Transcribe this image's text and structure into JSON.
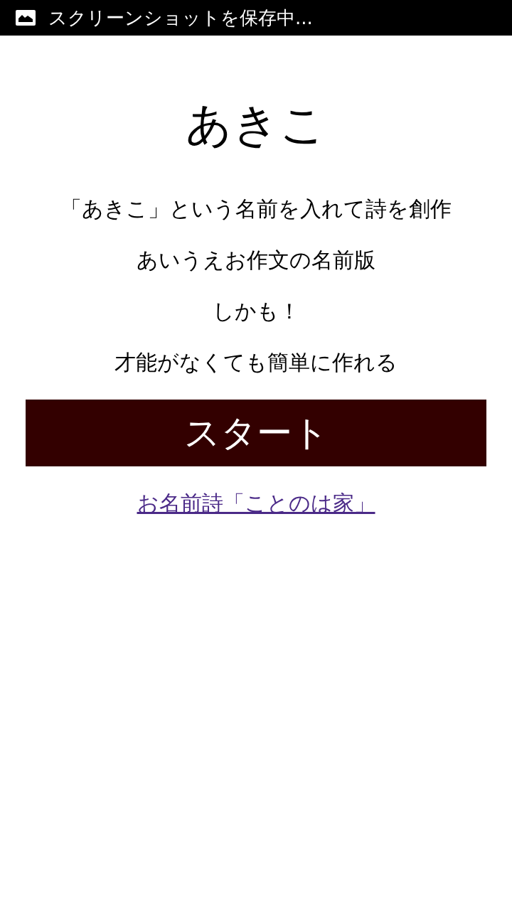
{
  "status_bar": {
    "notification": "スクリーンショットを保存中..."
  },
  "title": "あきこ",
  "description": [
    "「あきこ」という名前を入れて詩を創作",
    "あいうえお作文の名前版",
    "しかも！",
    "才能がなくても簡単に作れる"
  ],
  "start_button": {
    "label": "スタート"
  },
  "link": {
    "label": "お名前詩「ことのは家」"
  }
}
